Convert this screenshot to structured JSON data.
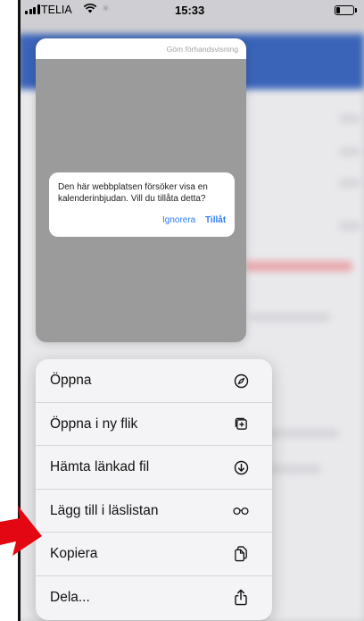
{
  "status_bar": {
    "carrier": "TELIA",
    "time": "15:33"
  },
  "preview": {
    "hide_preview_label": "Göm förhandsvisning",
    "alert": {
      "message": "Den här webbplatsen försöker visa en kalenderinbjudan. Vill du tillåta detta?",
      "ignore_label": "Ignorera",
      "allow_label": "Tillåt"
    }
  },
  "menu": {
    "items": [
      {
        "label": "Öppna",
        "icon": "compass-icon"
      },
      {
        "label": "Öppna i ny flik",
        "icon": "new-tab-icon"
      },
      {
        "label": "Hämta länkad fil",
        "icon": "download-icon"
      },
      {
        "label": "Lägg till i läslistan",
        "icon": "reading-glasses-icon"
      },
      {
        "label": "Kopiera",
        "icon": "copy-icon"
      },
      {
        "label": "Dela...",
        "icon": "share-icon"
      }
    ]
  },
  "colors": {
    "accent": "#2c7cf6",
    "annotation_arrow": "#e30613",
    "preview_background": "#9b9b9b",
    "menu_background": "#f4f4f6"
  }
}
